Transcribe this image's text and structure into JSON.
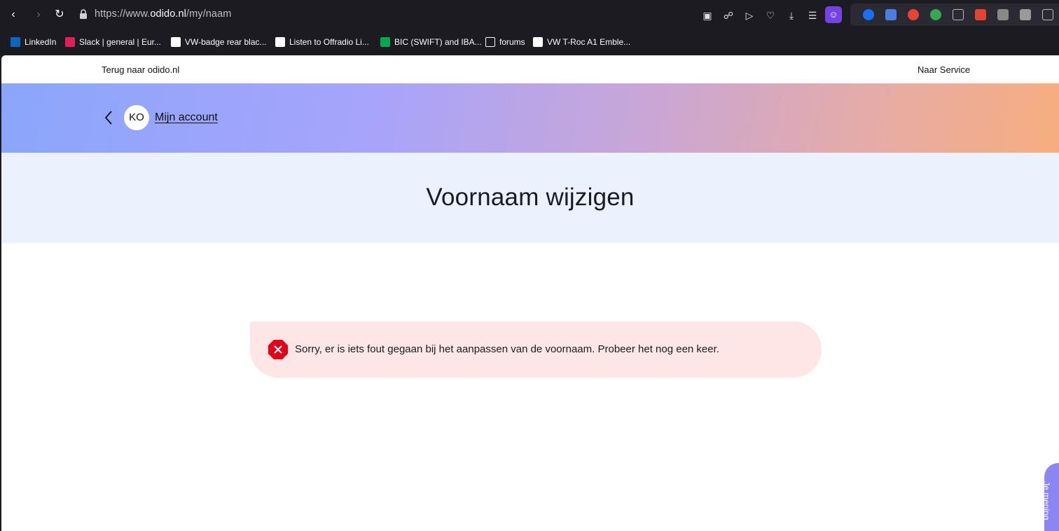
{
  "browser": {
    "url_prefix": "https://www.",
    "url_domain": "odido.nl",
    "url_path": "/my/naam",
    "profile_badge": "1"
  },
  "bookmarks": [
    {
      "label": "LinkedIn",
      "color": "#0a66c2"
    },
    {
      "label": "Slack | general | Eur...",
      "color": "#e01e5a"
    },
    {
      "label": "VW-badge rear blac...",
      "color": "#ffffff"
    },
    {
      "label": "Listen to Offradio Li...",
      "color": "#ffffff"
    },
    {
      "label": "BIC (SWIFT) and IBA...",
      "color": "#00a94f"
    },
    {
      "label": "forums",
      "color": "#fbfbfe"
    },
    {
      "label": "VW T-Roc A1 Emble...",
      "color": "#ffffff"
    }
  ],
  "page": {
    "back_link": "Terug naar odido.nl",
    "service_link": "Naar Service",
    "avatar_initials": "KO",
    "account_link": "Mijn account",
    "title": "Voornaam wijzigen",
    "error_message": "Sorry, er is iets fout gegaan bij het aanpassen van de voornaam. Probeer het nog een keer.",
    "feedback_label": "Je mening"
  },
  "colors": {
    "accent": "#7542e5",
    "error": "#e2001a",
    "error_bg": "#fde6e5",
    "title_band": "#ebf1fd"
  }
}
